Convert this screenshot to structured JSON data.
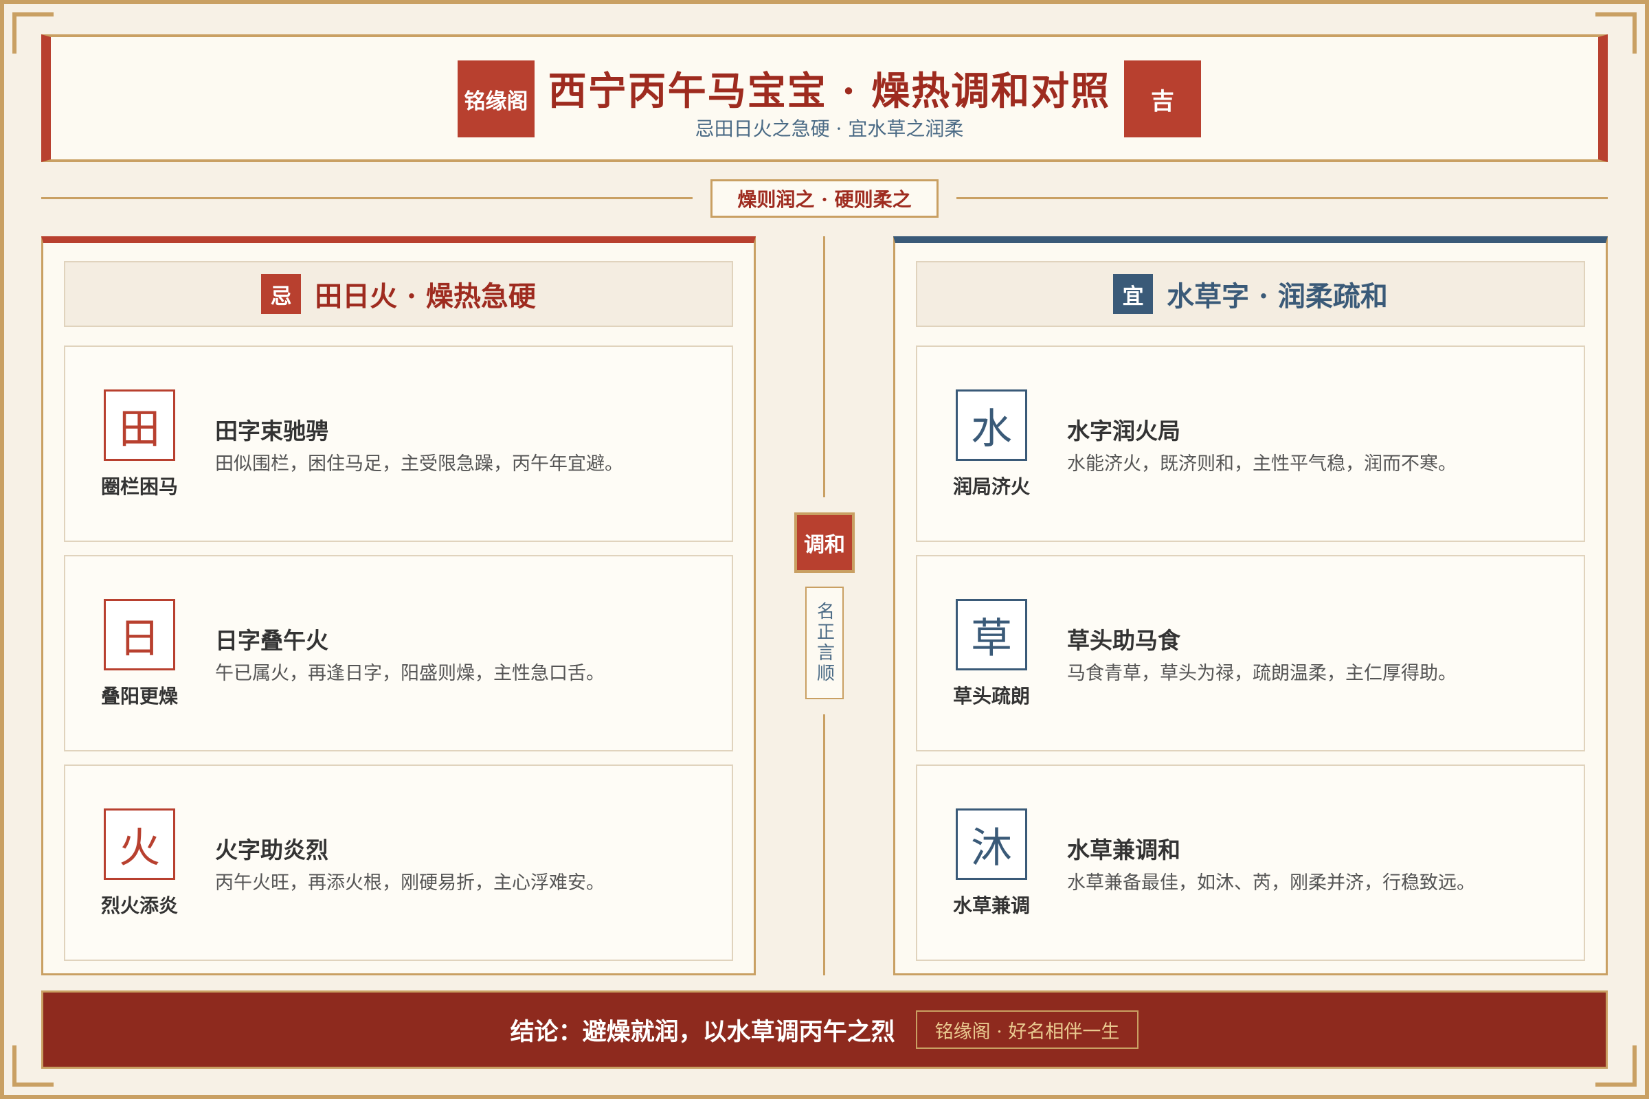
{
  "header": {
    "seal_left": "铭缘阁",
    "title": "西宁丙午马宝宝 · 燥热调和对照",
    "subtitle": "忌田日火之急硬 · 宜水草之润柔",
    "seal_right": "吉"
  },
  "divider_label": "燥则润之 · 硬则柔之",
  "left_panel": {
    "badge": "忌",
    "heading": "田日火 · 燥热急硬",
    "cards": [
      {
        "glyph": "田",
        "caption": "圈栏困马",
        "title": "田字束驰骋",
        "desc": "田似围栏，困住马足，主受限急躁，丙午年宜避。"
      },
      {
        "glyph": "日",
        "caption": "叠阳更燥",
        "title": "日字叠午火",
        "desc": "午已属火，再逢日字，阳盛则燥，主性急口舌。"
      },
      {
        "glyph": "火",
        "caption": "烈火添炎",
        "title": "火字助炎烈",
        "desc": "丙午火旺，再添火根，刚硬易折，主心浮难安。"
      }
    ]
  },
  "right_panel": {
    "badge": "宜",
    "heading": "水草字 · 润柔疏和",
    "cards": [
      {
        "glyph": "水",
        "caption": "润局济火",
        "title": "水字润火局",
        "desc": "水能济火，既济则和，主性平气稳，润而不寒。"
      },
      {
        "glyph": "草",
        "caption": "草头疏朗",
        "title": "草头助马食",
        "desc": "马食青草，草头为禄，疏朗温柔，主仁厚得助。"
      },
      {
        "glyph": "沐",
        "caption": "水草兼调",
        "title": "水草兼调和",
        "desc": "水草兼备最佳，如沐、芮，刚柔并济，行稳致远。"
      }
    ]
  },
  "center": {
    "seal": "调和",
    "vertical": "名正言顺"
  },
  "footer": {
    "conclusion": "结论：避燥就润，以水草调丙午之烈",
    "tag": "铭缘阁 · 好名相伴一生"
  },
  "colors": {
    "accent_red": "#b8402f",
    "accent_blue": "#3a5a78",
    "gold": "#c9a063",
    "footer_bg": "#8e2a1e"
  }
}
